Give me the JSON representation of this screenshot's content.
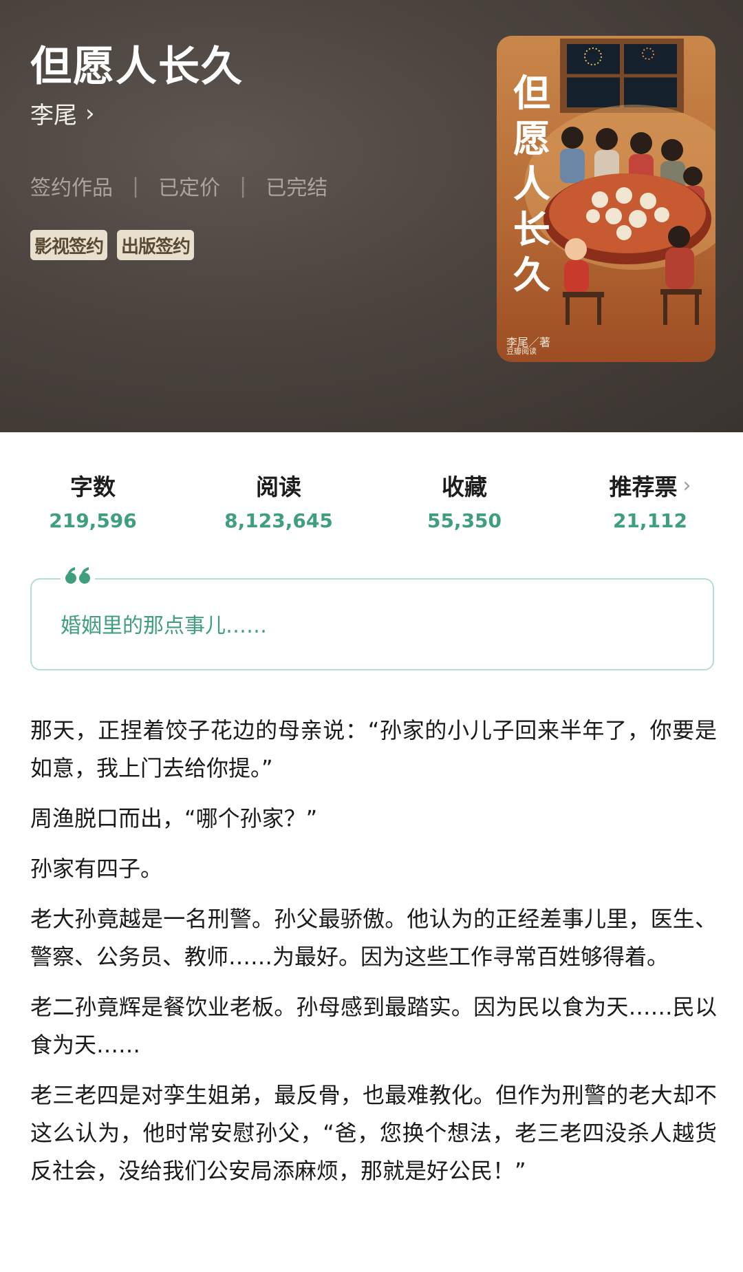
{
  "book": {
    "title": "但愿人长久",
    "author": "李尾",
    "author_chevron": "›",
    "meta": [
      "签约作品",
      "已定价",
      "已完结"
    ],
    "meta_sep": "|",
    "badges": [
      "影视签约",
      "出版签约"
    ]
  },
  "cover": {
    "title_chars": [
      "但",
      "愿",
      "人",
      "长",
      "久"
    ],
    "author": "李尾／著",
    "publisher": "豆瓣阅读"
  },
  "stats": [
    {
      "label": "字数",
      "value": "219,596"
    },
    {
      "label": "阅读",
      "value": "8,123,645"
    },
    {
      "label": "收藏",
      "value": "55,350"
    },
    {
      "label": "推荐票",
      "value": "21,112",
      "chevron": "›"
    }
  ],
  "quote": {
    "text": "婚姻里的那点事儿……"
  },
  "paragraphs": [
    "那天，正捏着饺子花边的母亲说：“孙家的小儿子回来半年了，你要是如意，我上门去给你提。”",
    "周渔脱口而出，“哪个孙家？”",
    "孙家有四子。",
    "老大孙竟越是一名刑警。孙父最骄傲。他认为的正经差事儿里，医生、警察、公务员、教师……为最好。因为这些工作寻常百姓够得着。",
    "老二孙竟辉是餐饮业老板。孙母感到最踏实。因为民以食为天……民以食为天……",
    "老三老四是对孪生姐弟，最反骨，也最难教化。但作为刑警的老大却不这么认为，他时常安慰孙父，“爸，您换个想法，老三老四没杀人越货反社会，没给我们公安局添麻烦，那就是好公民！”"
  ],
  "colors": {
    "accent": "#3f9e7d",
    "quote_border": "#b5ddd0",
    "badge_bg": "#e8dfcf"
  }
}
